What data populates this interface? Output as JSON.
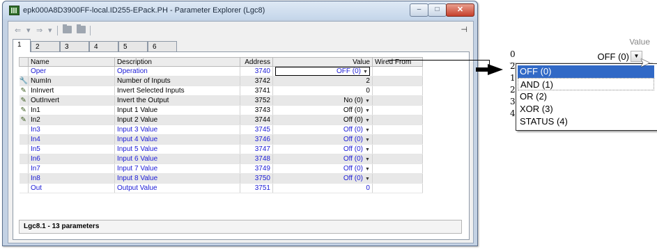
{
  "window": {
    "title": "epk000A8D3900FF-local.ID255-EPack.PH - Parameter Explorer (Lgc8)",
    "controls": {
      "minimize": "–",
      "maximize": "□",
      "close": "✕"
    }
  },
  "toolbar": {
    "back": "⇐",
    "forward": "⇒",
    "dropdown": "▾",
    "pin": "⊣"
  },
  "tabs": [
    {
      "label": "1"
    },
    {
      "label": "2"
    },
    {
      "label": "3"
    },
    {
      "label": "4"
    },
    {
      "label": "5"
    },
    {
      "label": "6"
    }
  ],
  "grid": {
    "headers": {
      "name": "Name",
      "description": "Description",
      "address": "Address",
      "value": "Value",
      "wired": "Wired From"
    },
    "rows": [
      {
        "icon": "",
        "name": "Oper",
        "description": "Operation",
        "address": "3740",
        "value": "OFF (0)",
        "dropdown": true,
        "wired": ""
      },
      {
        "icon": "wrench-icon",
        "name": "NumIn",
        "description": "Number of Inputs",
        "address": "3742",
        "value": "2",
        "dropdown": false,
        "wired": ""
      },
      {
        "icon": "pencil-icon",
        "name": "InInvert",
        "description": "Invert Selected Inputs",
        "address": "3741",
        "value": "0",
        "dropdown": false,
        "wired": ""
      },
      {
        "icon": "pencil-icon",
        "name": "OutInvert",
        "description": "Invert the Output",
        "address": "3752",
        "value": "No (0)",
        "dropdown": true,
        "wired": ""
      },
      {
        "icon": "pencil-icon",
        "name": "In1",
        "description": "Input 1 Value",
        "address": "3743",
        "value": "Off (0)",
        "dropdown": true,
        "wired": ""
      },
      {
        "icon": "pencil-icon",
        "name": "In2",
        "description": "Input 2 Value",
        "address": "3744",
        "value": "Off (0)",
        "dropdown": true,
        "wired": ""
      },
      {
        "icon": "",
        "name": "In3",
        "description": "Input 3 Value",
        "address": "3745",
        "value": "Off (0)",
        "dropdown": true,
        "wired": ""
      },
      {
        "icon": "",
        "name": "In4",
        "description": "Input 4 Value",
        "address": "3746",
        "value": "Off (0)",
        "dropdown": true,
        "wired": ""
      },
      {
        "icon": "",
        "name": "In5",
        "description": "Input 5 Value",
        "address": "3747",
        "value": "Off (0)",
        "dropdown": true,
        "wired": ""
      },
      {
        "icon": "",
        "name": "In6",
        "description": "Input 6 Value",
        "address": "3748",
        "value": "Off (0)",
        "dropdown": true,
        "wired": ""
      },
      {
        "icon": "",
        "name": "In7",
        "description": "Input 7 Value",
        "address": "3749",
        "value": "Off (0)",
        "dropdown": true,
        "wired": ""
      },
      {
        "icon": "",
        "name": "In8",
        "description": "Input 8 Value",
        "address": "3750",
        "value": "Off (0)",
        "dropdown": true,
        "wired": ""
      },
      {
        "icon": "",
        "name": "Out",
        "description": "Output Value",
        "address": "3751",
        "value": "0",
        "dropdown": false,
        "wired": ""
      }
    ]
  },
  "status": "Lgc8.1  -  13 parameters",
  "callout": {
    "header": "Value",
    "current_value": "OFF (0)",
    "edge_digits": [
      "0",
      "2",
      "1",
      "2",
      "3",
      "4"
    ],
    "options": [
      "OFF (0)",
      "AND (1)",
      "OR (2)",
      "XOR (3)",
      "STATUS (4)"
    ]
  },
  "colors": {
    "blue_text": "#1b1bd6",
    "highlight": "#3169c6",
    "title_bar": "#c5d6ea"
  }
}
